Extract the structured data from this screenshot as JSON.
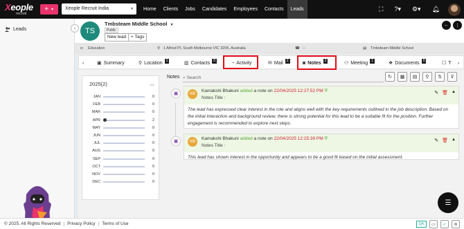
{
  "app": {
    "brand_x": "X",
    "brand_rest": "eople",
    "brand_sub": "recruit",
    "org_selector": "Xeople Recruit India",
    "accent_color": "#e8336d"
  },
  "nav": {
    "links": [
      "Home",
      "Clients",
      "Jobs",
      "Candidates",
      "Employees",
      "Contacts",
      "Leads"
    ],
    "active": "Leads"
  },
  "sidebar": {
    "item_label": "Leads"
  },
  "lead": {
    "initials": "TS",
    "name": "Tmbsteam Middle School",
    "visibility_badge": "Public",
    "new_lead_label": "New lead",
    "tags_label": "+ Tags",
    "info": {
      "category": "Education",
      "address": "1 Alfred Pl, South Melbourne VIC 3205, Australia",
      "phone": "--",
      "company": "Tmbsteam Middle School"
    }
  },
  "tabs": [
    {
      "label": "Summary",
      "icon": "summary-icon",
      "count": ""
    },
    {
      "label": "Location",
      "icon": "location-pin-icon",
      "count": "1"
    },
    {
      "label": "Contacts",
      "icon": "contacts-icon",
      "count": "0"
    },
    {
      "label": "Activity",
      "icon": "activity-icon",
      "count": ""
    },
    {
      "label": "Mail",
      "icon": "mail-icon",
      "count": "2"
    },
    {
      "label": "Notes",
      "icon": "notes-icon",
      "count": "2"
    },
    {
      "label": "Meeting",
      "icon": "meeting-icon",
      "count": "1"
    },
    {
      "label": "Documents",
      "icon": "documents-icon",
      "count": "0"
    },
    {
      "label": "T",
      "icon": "task-icon",
      "count": ""
    }
  ],
  "timeline_filter": {
    "year_label": "2025(2)",
    "months": [
      {
        "m": "JAN",
        "c": "0"
      },
      {
        "m": "FEB",
        "c": "0"
      },
      {
        "m": "MAR",
        "c": "0"
      },
      {
        "m": "APR",
        "c": "2"
      },
      {
        "m": "MAY",
        "c": "0"
      },
      {
        "m": "JUN",
        "c": "0"
      },
      {
        "m": "JUL",
        "c": "0"
      },
      {
        "m": "AUG",
        "c": "0"
      },
      {
        "m": "SEP",
        "c": "0"
      },
      {
        "m": "OCT",
        "c": "0"
      },
      {
        "m": "NOV",
        "c": "0"
      },
      {
        "m": "DEC",
        "c": "0"
      }
    ]
  },
  "notes_panel": {
    "label": "Notes",
    "search_placeholder": "Search",
    "notes": [
      {
        "initials": "KB",
        "author": "Kamakshi Bhakuni",
        "action": "added",
        "action_rest": " a note on ",
        "timestamp": "22/04/2025 12:27:52 PM",
        "title_label": "Notes Title :",
        "body": "The lead has expressed clear interest in the role and aligns well with the key requirements outlined in the job description. Based on the initial interaction and background review, there is strong potential for this lead to be a suitable fit for the position. Further engagement is recommended to explore next steps."
      },
      {
        "initials": "KB",
        "author": "Kamakshi Bhakuni",
        "action": "added",
        "action_rest": " a note on ",
        "timestamp": "22/04/2025 12:25:39 PM",
        "title_label": "Notes Title :",
        "body": "This lead has shown interest in the opportunity and appears to be a good fit based on the initial assessment."
      }
    ]
  },
  "footer": {
    "copyright": "© 2025. All Rights Reserved",
    "privacy": "Privacy Policy",
    "terms": "Terms of Use",
    "qa": "QA"
  }
}
